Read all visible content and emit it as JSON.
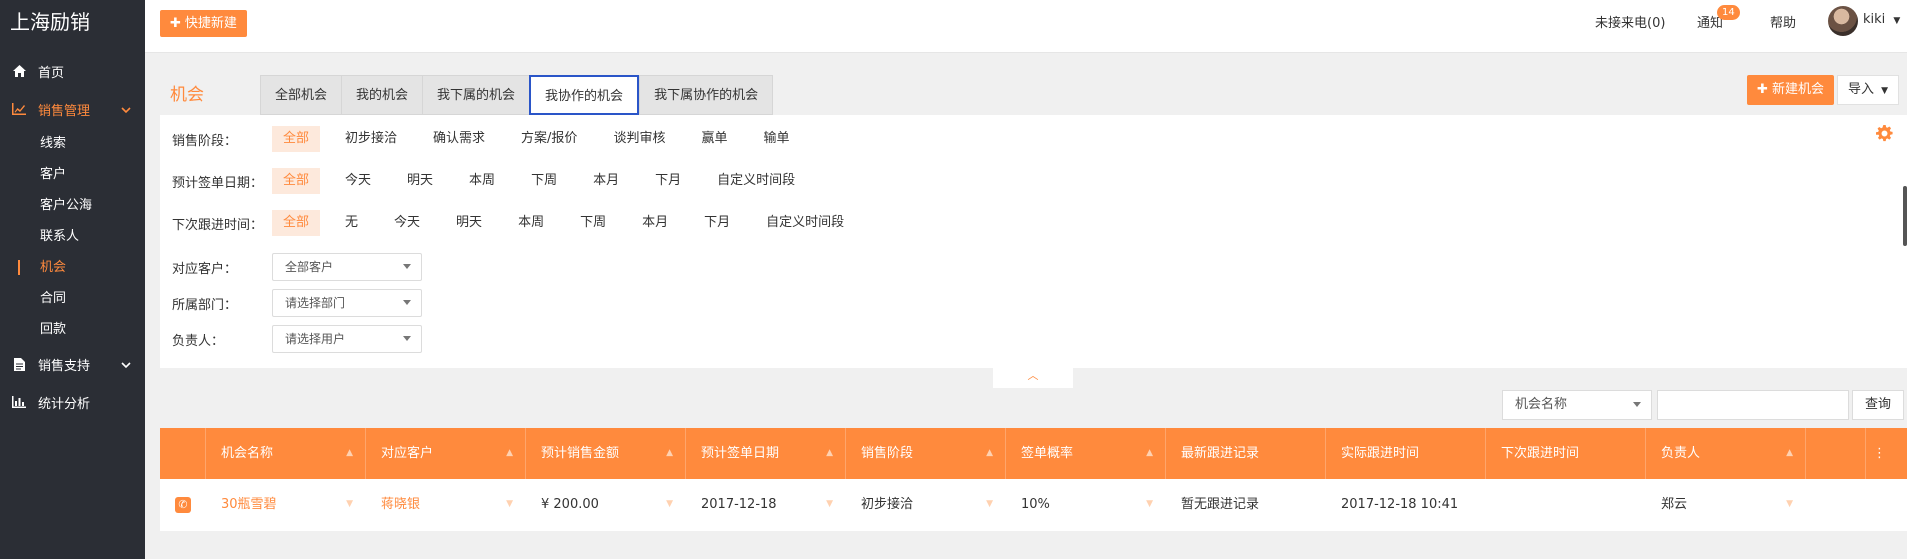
{
  "sidebar": {
    "brand": "上海励销",
    "nav": [
      {
        "label": "首页",
        "icon": "home-icon"
      },
      {
        "label": "销售管理",
        "icon": "chart-icon"
      },
      {
        "label": "销售支持",
        "icon": "document-icon"
      },
      {
        "label": "统计分析",
        "icon": "bar-chart-icon"
      }
    ],
    "sales_sub": [
      "线索",
      "客户",
      "客户公海",
      "联系人",
      "机会",
      "合同",
      "回款"
    ]
  },
  "topbar": {
    "quick_create": "快捷新建",
    "missed_calls": "未接来电(0)",
    "notifications": "通知",
    "notification_count": "14",
    "help": "帮助",
    "user": "kiki"
  },
  "page": {
    "title": "机会",
    "tabs": [
      "全部机会",
      "我的机会",
      "我下属的机会",
      "我协作的机会",
      "我下属协作的机会"
    ],
    "active_tab": "我协作的机会",
    "new_button": "新建机会",
    "import_button": "导入"
  },
  "filters": {
    "stage": {
      "label": "销售阶段：",
      "options": [
        "全部",
        "初步接洽",
        "确认需求",
        "方案/报价",
        "谈判审核",
        "赢单",
        "输单"
      ]
    },
    "sign_date": {
      "label": "预计签单日期：",
      "options": [
        "全部",
        "今天",
        "明天",
        "本周",
        "下周",
        "本月",
        "下月",
        "自定义时间段"
      ]
    },
    "next_follow": {
      "label": "下次跟进时间：",
      "options": [
        "全部",
        "无",
        "今天",
        "明天",
        "本周",
        "下周",
        "本月",
        "下月",
        "自定义时间段"
      ]
    },
    "customer": {
      "label": "对应客户：",
      "value": "全部客户"
    },
    "department": {
      "label": "所属部门：",
      "value": "请选择部门"
    },
    "owner": {
      "label": "负责人：",
      "value": "请选择用户"
    }
  },
  "search": {
    "field": "机会名称",
    "button": "查询",
    "input_value": ""
  },
  "table": {
    "columns": [
      "机会名称",
      "对应客户",
      "预计销售金额",
      "预计签单日期",
      "销售阶段",
      "签单概率",
      "最新跟进记录",
      "实际跟进时间",
      "下次跟进时间",
      "负责人"
    ],
    "rows": [
      [
        "30瓶雪碧",
        "蒋晓银",
        "¥ 200.00",
        "2017-12-18",
        "初步接洽",
        "10%",
        "暂无跟进记录",
        "2017-12-18 10:41",
        "",
        "郑云"
      ]
    ]
  },
  "accent_color": "#ff8a3d"
}
